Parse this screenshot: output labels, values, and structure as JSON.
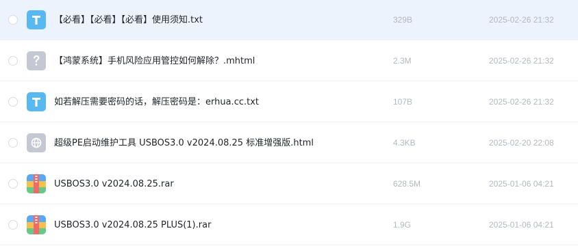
{
  "files": [
    {
      "name": "【必看】【必看】【必看】使用须知.txt",
      "size": "329B",
      "date": "2025-02-26 21:32",
      "icon": "txt-file-icon"
    },
    {
      "name": "【鸿蒙系统】手机风险应用管控如何解除？.mhtml",
      "size": "2.3M",
      "date": "2025-02-26 21:32",
      "icon": "unknown-file-icon"
    },
    {
      "name": "如若解压需要密码的话，解压密码是：erhua.cc.txt",
      "size": "107B",
      "date": "2025-02-26 21:32",
      "icon": "txt-file-icon"
    },
    {
      "name": "超级PE启动维护工具 USBOS3.0 v2024.08.25 标准增强版.html",
      "size": "4.3KB",
      "date": "2025-02-20 22:08",
      "icon": "web-file-icon"
    },
    {
      "name": "USBOS3.0 v2024.08.25.rar",
      "size": "628.5M",
      "date": "2025-01-06 04:21",
      "icon": "archive-file-icon"
    },
    {
      "name": "USBOS3.0 v2024.08.25 PLUS(1).rar",
      "size": "1.9G",
      "date": "2025-01-06 04:21",
      "icon": "archive-file-icon"
    }
  ],
  "colors": {
    "hover_row": "#edf3fc",
    "txt_icon": "#58b9f2",
    "unknown_icon": "#c3c8d2",
    "web_icon": "#c3c8d2",
    "text": "#1f2329",
    "meta_text": "#b3b8c0"
  }
}
